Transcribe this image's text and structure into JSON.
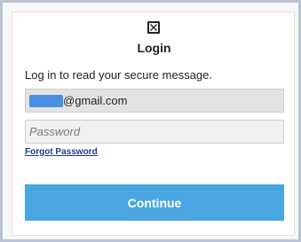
{
  "login": {
    "title": "Login",
    "subtitle": "Log in to read your secure message.",
    "email": {
      "value": "@gmail.com"
    },
    "password": {
      "placeholder": "Password"
    },
    "forgot_label": "Forgot Password",
    "continue_label": "Continue"
  },
  "icons": {
    "logo": "envelope-x-icon"
  },
  "colors": {
    "button_bg": "#4aa6e0",
    "link": "#1f3c8f",
    "redaction": "#4a90e2",
    "frame_border": "#b9c3d1"
  }
}
